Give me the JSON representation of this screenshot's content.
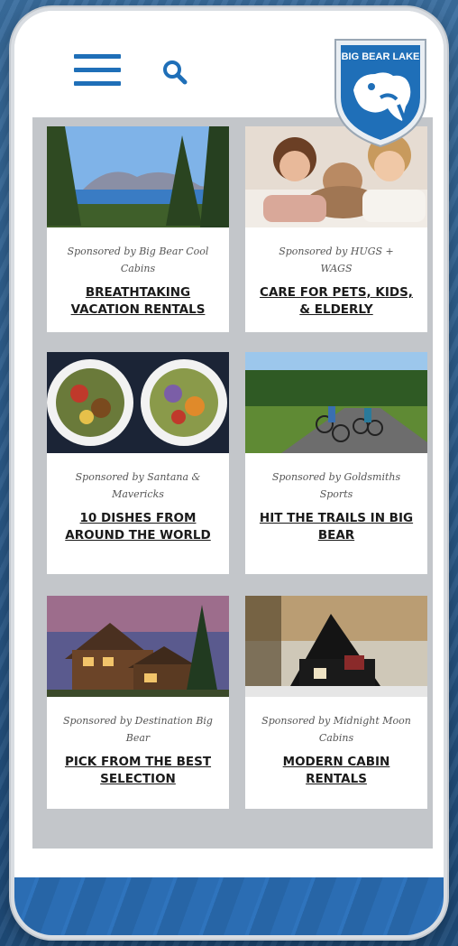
{
  "header": {
    "logo_text": "BIG BEAR LAKE",
    "menu_icon": "hamburger-icon",
    "search_icon": "search-icon"
  },
  "colors": {
    "brand_blue": "#1f6fb8",
    "grid_gray": "#c3c6ca"
  },
  "cards": [
    {
      "sponsor": "Sponsored by Big Bear Cool Cabins",
      "title": "BREATHTAKING VACATION RENTALS"
    },
    {
      "sponsor": "Sponsored by HUGS + WAGS",
      "title": "CARE FOR PETS, KIDS, & ELDERLY"
    },
    {
      "sponsor": "Sponsored by Santana & Mavericks",
      "title": "10 DISHES FROM AROUND THE WORLD"
    },
    {
      "sponsor": "Sponsored by Goldsmiths Sports",
      "title": "HIT THE TRAILS IN BIG BEAR"
    },
    {
      "sponsor": "Sponsored by Destination Big Bear",
      "title": "PICK FROM THE BEST SELECTION"
    },
    {
      "sponsor": "Sponsored by Midnight Moon Cabins",
      "title": "MODERN CABIN RENTALS"
    }
  ]
}
